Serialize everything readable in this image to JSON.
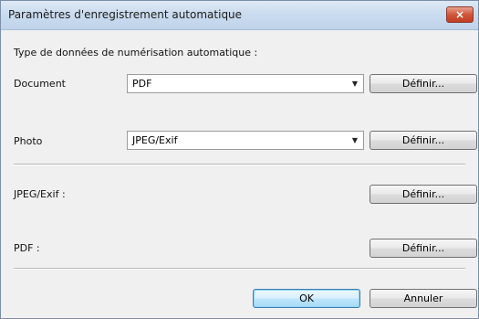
{
  "window": {
    "title": "Paramètres d'enregistrement automatique",
    "close_label": "×"
  },
  "section": {
    "scan_type_label": "Type de données de numérisation automatique :"
  },
  "rows": {
    "document": {
      "label": "Document",
      "selected": "PDF",
      "define_label": "Définir..."
    },
    "photo": {
      "label": "Photo",
      "selected": "JPEG/Exif",
      "define_label": "Définir..."
    },
    "jpeg": {
      "label": "JPEG/Exif :",
      "define_label": "Définir..."
    },
    "pdf": {
      "label": "PDF :",
      "define_label": "Définir..."
    }
  },
  "footer": {
    "ok_label": "OK",
    "cancel_label": "Annuler"
  },
  "icons": {
    "dropdown": "chevron-down-icon",
    "close": "close-icon"
  },
  "colors": {
    "titlebar": "#cbdcef",
    "dialog_bg": "#f0f0f0",
    "close_button": "#c13d22",
    "default_button_border": "#3c7fb1"
  }
}
